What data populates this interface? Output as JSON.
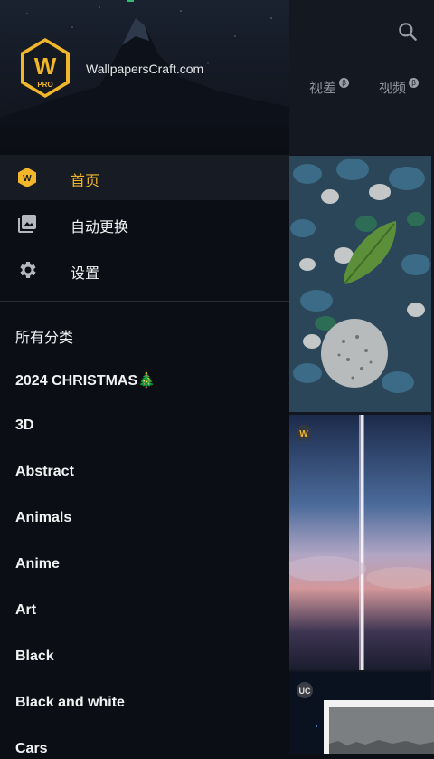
{
  "header": {
    "site_name": "WallpapersCraft.com",
    "logo_letter": "W",
    "logo_badge": "PRO"
  },
  "nav": {
    "items": [
      {
        "label": "首页",
        "icon": "home-w-icon",
        "active": true
      },
      {
        "label": "自动更换",
        "icon": "photo-library-icon",
        "active": false
      },
      {
        "label": "设置",
        "icon": "gear-icon",
        "active": false
      }
    ]
  },
  "categories": {
    "header": "所有分类",
    "items": [
      "2024 CHRISTMAS🎄",
      "3D",
      "Abstract",
      "Animals",
      "Anime",
      "Art",
      "Black",
      "Black and white",
      "Cars"
    ]
  },
  "background": {
    "tabs": [
      "视差",
      "视频"
    ],
    "tab_badge": "β",
    "thumb_badges": [
      "W",
      "UC"
    ]
  },
  "colors": {
    "accent": "#f2b62b",
    "drawer_bg": "#0b0e14",
    "active_row_bg": "#171b24"
  }
}
